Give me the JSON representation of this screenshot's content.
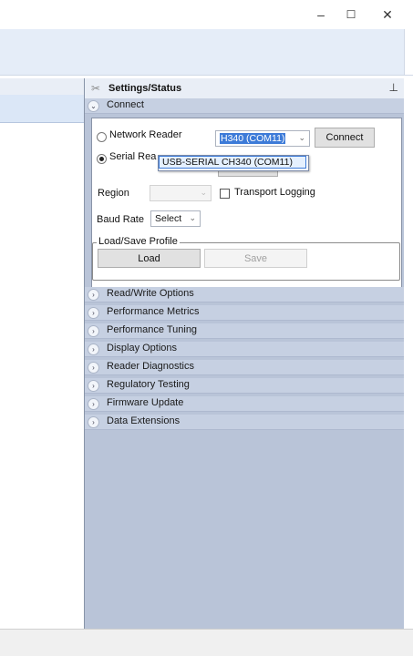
{
  "window": {
    "minimize_glyph": "–",
    "maximize_glyph": "☐",
    "close_glyph": "✕"
  },
  "panel": {
    "title": "Settings/Status",
    "icon": "tools-icon",
    "pin_glyph": "⊥"
  },
  "connect": {
    "header": "Connect",
    "network_reader_label": "Network Reader",
    "serial_reader_label": "Serial Rea",
    "serial_reader_selected": true,
    "port_value": "H340 (COM11)",
    "dropdown_option": "USB-SERIAL CH340 (COM11)",
    "connect_button": "Connect",
    "region_label": "Region",
    "region_value": "",
    "transport_logging_label": "Transport Logging",
    "transport_logging_checked": false,
    "baud_rate_label": "Baud Rate",
    "baud_rate_value": "Select",
    "profile_group_title": "Load/Save Profile",
    "load_button": "Load",
    "save_button": "Save"
  },
  "sections": [
    "Read/Write Options",
    "Performance Metrics",
    "Performance Tuning",
    "Display Options",
    "Reader Diagnostics",
    "Regulatory Testing",
    "Firmware Update",
    "Data Extensions"
  ],
  "colors": {
    "pane_background": "#b9c4d8",
    "header_background": "#c6d0e2",
    "selection_highlight": "#3d7bd8"
  }
}
